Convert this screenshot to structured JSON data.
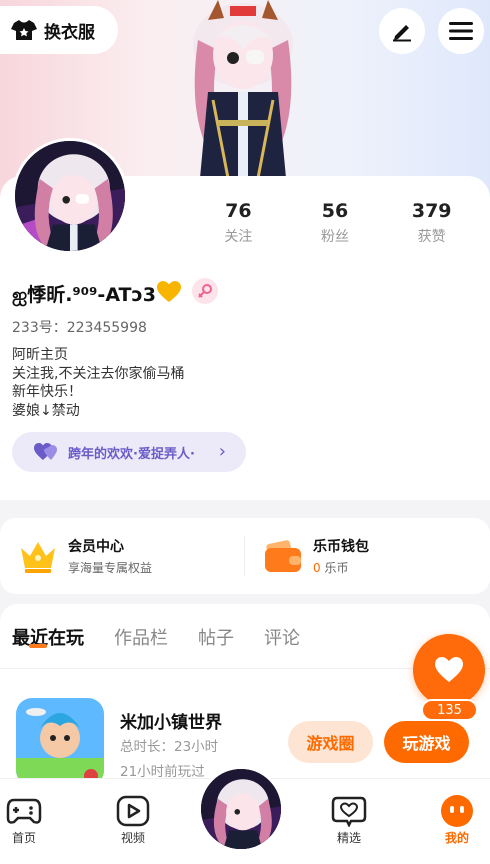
{
  "header": {
    "dress_up_label": "换衣服"
  },
  "profile": {
    "username": "ஐ悸昕.⁹⁰⁹-ATↄ3",
    "uid_label": "233号：223455998",
    "bio": [
      "阿昕主页",
      "关注我,不关注去你家偷马桶",
      "新年快乐！",
      "婆娘↓禁动"
    ],
    "fan_group": "跨年的欢欢·爱捉弄人·",
    "stats": [
      {
        "num": "76",
        "label": "关注"
      },
      {
        "num": "56",
        "label": "粉丝"
      },
      {
        "num": "379",
        "label": "获赞"
      }
    ]
  },
  "promo": {
    "vip_title": "会员中心",
    "vip_sub": "享海量专属权益",
    "wallet_title": "乐币钱包",
    "wallet_amount": "0",
    "wallet_unit": " 乐币"
  },
  "tabs": [
    {
      "label": "最近在玩",
      "active": true
    },
    {
      "label": "作品栏",
      "active": false
    },
    {
      "label": "帖子",
      "active": false
    },
    {
      "label": "评论",
      "active": false
    }
  ],
  "game": {
    "title": "米加小镇世界",
    "duration": "总时长：23小时",
    "last_played": "21小时前玩过",
    "circle_button": "游戏圈",
    "play_button": "玩游戏"
  },
  "like": {
    "count": "135"
  },
  "nav": [
    {
      "label": "首页",
      "icon": "gamepad-icon"
    },
    {
      "label": "视频",
      "icon": "video-play-icon"
    },
    {
      "label": "精选",
      "icon": "heart-chat-icon"
    },
    {
      "label": "我的",
      "icon": "mine-face-icon"
    }
  ],
  "colors": {
    "accent": "#ff6a00",
    "fan_purple": "#6a5bc9"
  }
}
